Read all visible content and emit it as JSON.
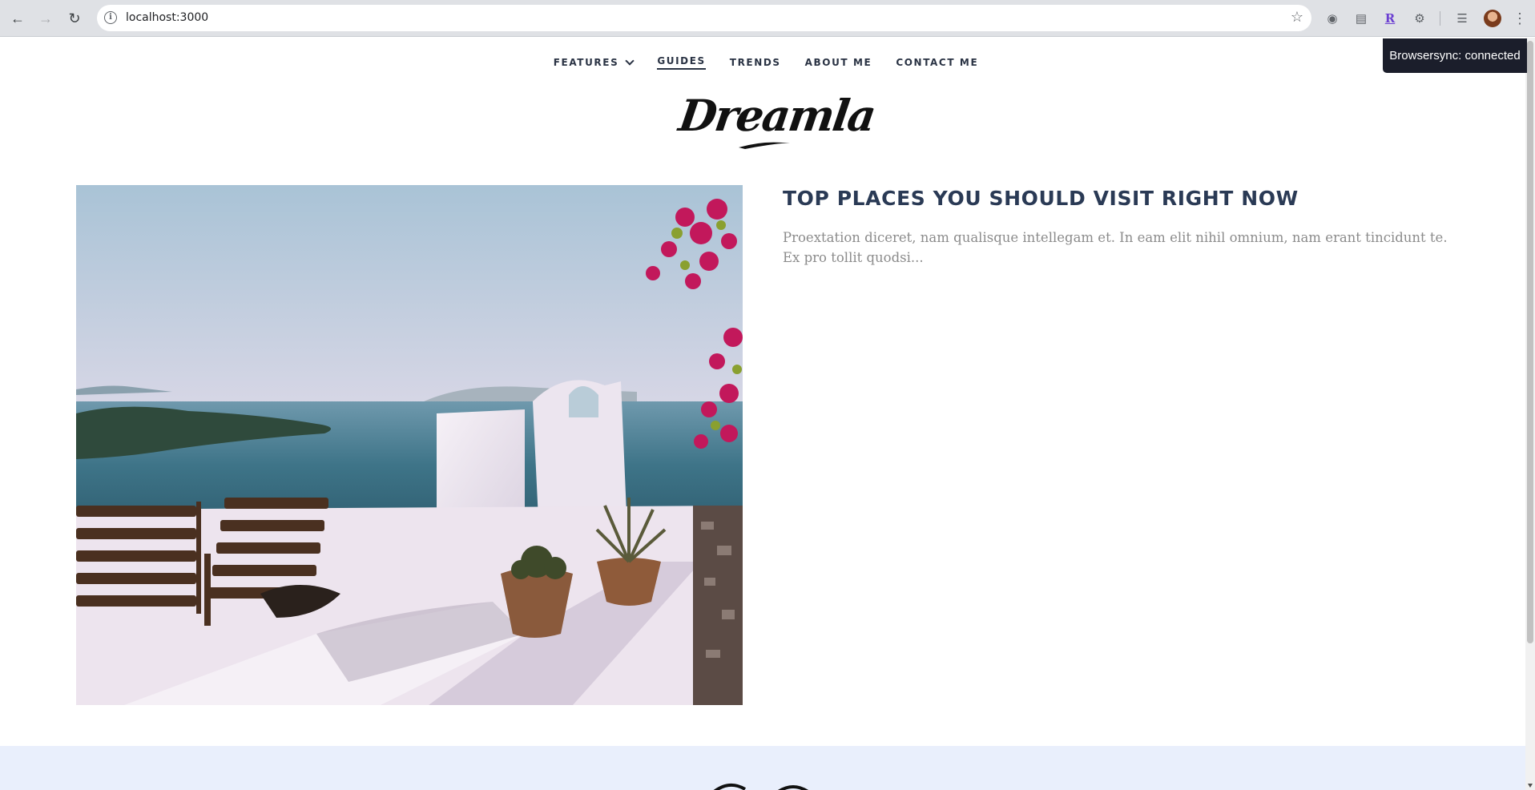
{
  "browser": {
    "url": "localhost:3000"
  },
  "nav": {
    "items": [
      {
        "label": "FEATURES",
        "has_dropdown": true
      },
      {
        "label": "GUIDES",
        "active": true
      },
      {
        "label": "TRENDS"
      },
      {
        "label": "ABOUT ME"
      },
      {
        "label": "CONTACT ME"
      }
    ]
  },
  "logo": {
    "text": "Dreamla"
  },
  "post": {
    "title": "TOP PLACES YOU SHOULD VISIT RIGHT NOW",
    "excerpt": "Proextation diceret, nam qualisque intellegam et. In eam elit nihil omnium, nam erant tincidunt te. Ex pro tollit quodsi..."
  },
  "toast": {
    "text": "Browsersync: connected"
  },
  "colors": {
    "heading": "#2a3a55",
    "excerpt": "#8b8b8b",
    "footer_band": "#e9effc",
    "toast_bg": "#1b1e2b"
  }
}
